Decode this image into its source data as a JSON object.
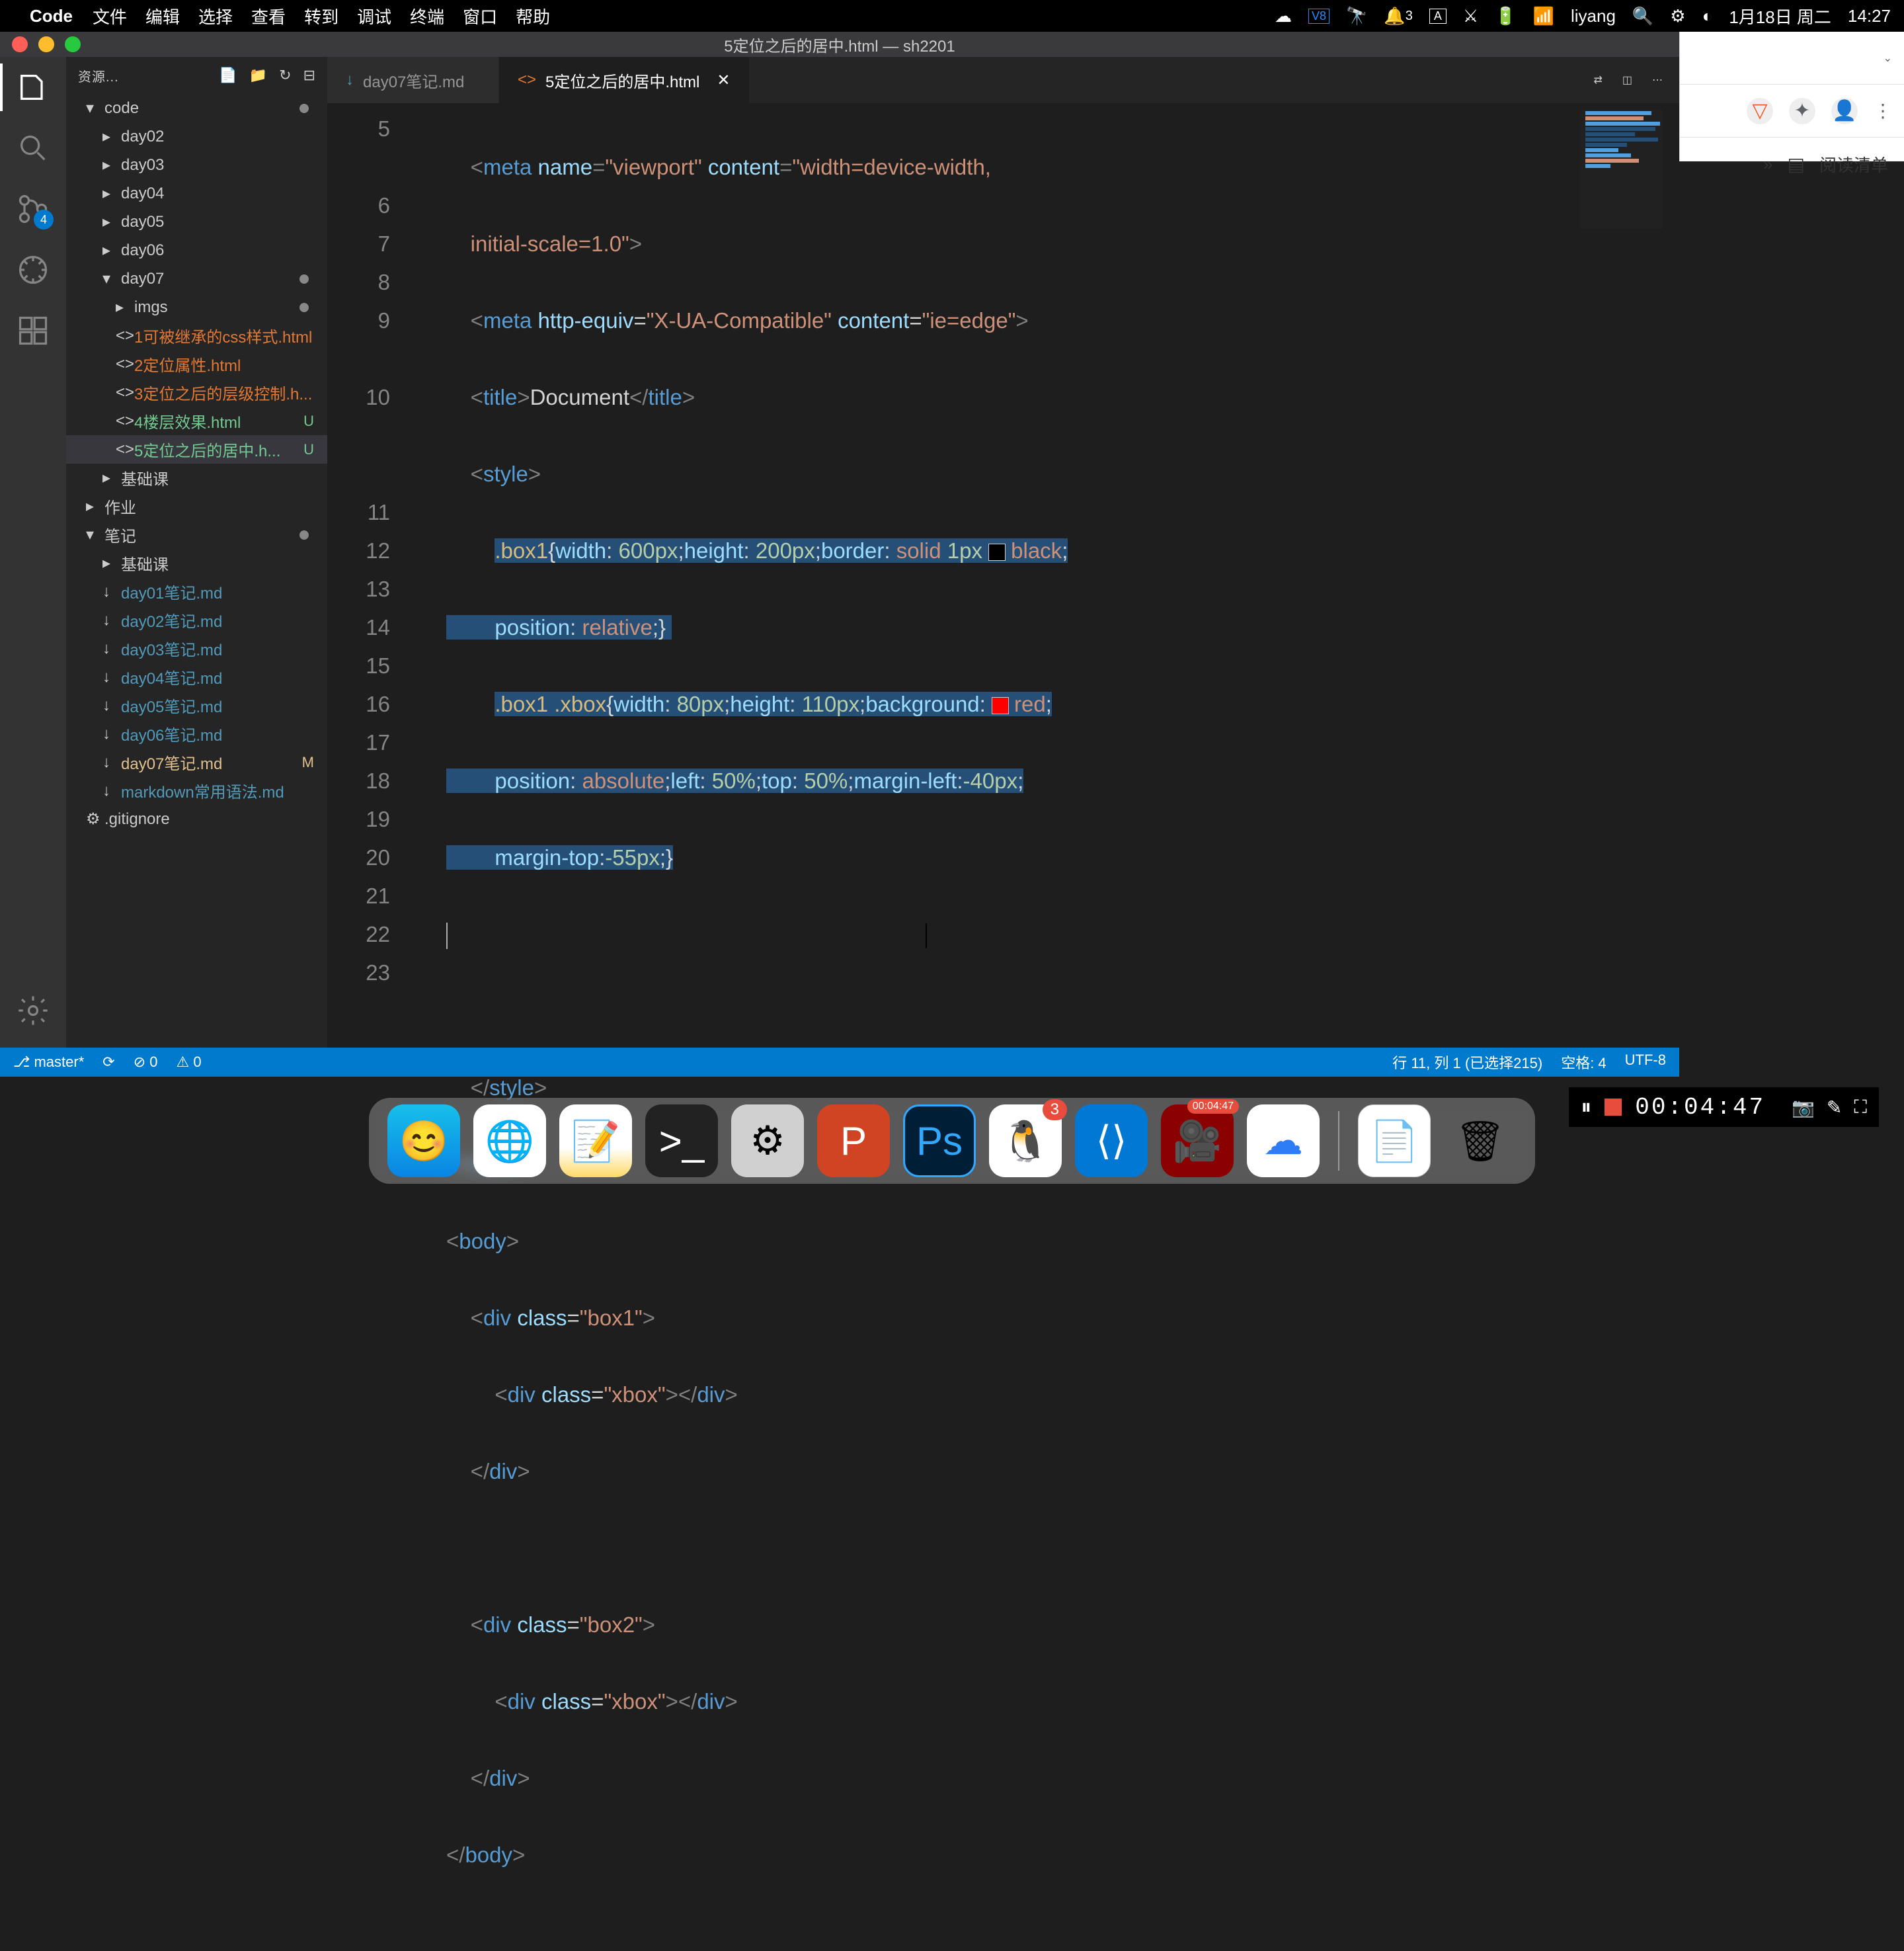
{
  "menubar": {
    "appname": "Code",
    "items": [
      "文件",
      "编辑",
      "选择",
      "查看",
      "转到",
      "调试",
      "终端",
      "窗口",
      "帮助"
    ],
    "notif_count": "3",
    "user": "liyang",
    "date": "1月18日 周二",
    "time": "14:27"
  },
  "window": {
    "title": "5定位之后的居中.html — sh2201"
  },
  "sidebar": {
    "header": "资源...",
    "scm_badge": "4",
    "tree": [
      {
        "level": 1,
        "chev": "▾",
        "name": "code",
        "folder": true,
        "dot": true
      },
      {
        "level": 2,
        "chev": "▸",
        "name": "day02",
        "folder": true
      },
      {
        "level": 2,
        "chev": "▸",
        "name": "day03",
        "folder": true
      },
      {
        "level": 2,
        "chev": "▸",
        "name": "day04",
        "folder": true
      },
      {
        "level": 2,
        "chev": "▸",
        "name": "day05",
        "folder": true
      },
      {
        "level": 2,
        "chev": "▸",
        "name": "day06",
        "folder": true
      },
      {
        "level": 2,
        "chev": "▾",
        "name": "day07",
        "folder": true,
        "dot": true,
        "open": true
      },
      {
        "level": 3,
        "chev": "▸",
        "name": "imgs",
        "folder": true,
        "dot": true
      },
      {
        "level": 3,
        "icon": "<>",
        "name": "1可被继承的css样式.html",
        "cls": "file-orange"
      },
      {
        "level": 3,
        "icon": "<>",
        "name": "2定位属性.html",
        "cls": "file-orange"
      },
      {
        "level": 3,
        "icon": "<>",
        "name": "3定位之后的层级控制.h...",
        "cls": "file-orange"
      },
      {
        "level": 3,
        "icon": "<>",
        "name": "4楼层效果.html",
        "cls": "file-green",
        "status": "U"
      },
      {
        "level": 3,
        "icon": "<>",
        "name": "5定位之后的居中.h...",
        "cls": "file-green",
        "status": "U",
        "active": true
      },
      {
        "level": 2,
        "chev": "▸",
        "name": "基础课",
        "folder": true
      },
      {
        "level": 1,
        "chev": "▸",
        "name": "作业",
        "folder": true
      },
      {
        "level": 1,
        "chev": "▾",
        "name": "笔记",
        "folder": true,
        "dot": true
      },
      {
        "level": 2,
        "chev": "▸",
        "name": "基础课",
        "folder": true
      },
      {
        "level": 2,
        "icon": "↓",
        "name": "day01笔记.md",
        "cls": "file-blue"
      },
      {
        "level": 2,
        "icon": "↓",
        "name": "day02笔记.md",
        "cls": "file-blue"
      },
      {
        "level": 2,
        "icon": "↓",
        "name": "day03笔记.md",
        "cls": "file-blue"
      },
      {
        "level": 2,
        "icon": "↓",
        "name": "day04笔记.md",
        "cls": "file-blue"
      },
      {
        "level": 2,
        "icon": "↓",
        "name": "day05笔记.md",
        "cls": "file-blue"
      },
      {
        "level": 2,
        "icon": "↓",
        "name": "day06笔记.md",
        "cls": "file-blue"
      },
      {
        "level": 2,
        "icon": "↓",
        "name": "day07笔记.md",
        "cls": "file-mod",
        "status": "M"
      },
      {
        "level": 2,
        "icon": "↓",
        "name": "markdown常用语法.md",
        "cls": "file-blue"
      },
      {
        "level": 1,
        "icon": "⚙",
        "name": ".gitignore",
        "cls": ""
      }
    ]
  },
  "tabs": [
    {
      "icon": "↓",
      "label": "day07笔记.md",
      "active": false,
      "cls": "file-blue"
    },
    {
      "icon": "<>",
      "label": "5定位之后的居中.html",
      "active": true,
      "cls": "file-orange",
      "close": true
    }
  ],
  "line_numbers": [
    "5",
    "6",
    "7",
    "8",
    "9",
    "10",
    "11",
    "12",
    "13",
    "14",
    "15",
    "16",
    "17",
    "18",
    "19",
    "20",
    "21",
    "22",
    "23"
  ],
  "statusbar": {
    "branch": "master*",
    "errors": "0",
    "warnings": "0",
    "position": "行 11, 列 1 (已选择215)",
    "spaces": "空格: 4",
    "encoding": "UTF-8"
  },
  "chrome": {
    "reading_list": "阅读清单"
  },
  "recorder": {
    "time": "00:04:47"
  },
  "dock": {
    "qq_badge": "3",
    "rec_badge": "00:04:47"
  }
}
